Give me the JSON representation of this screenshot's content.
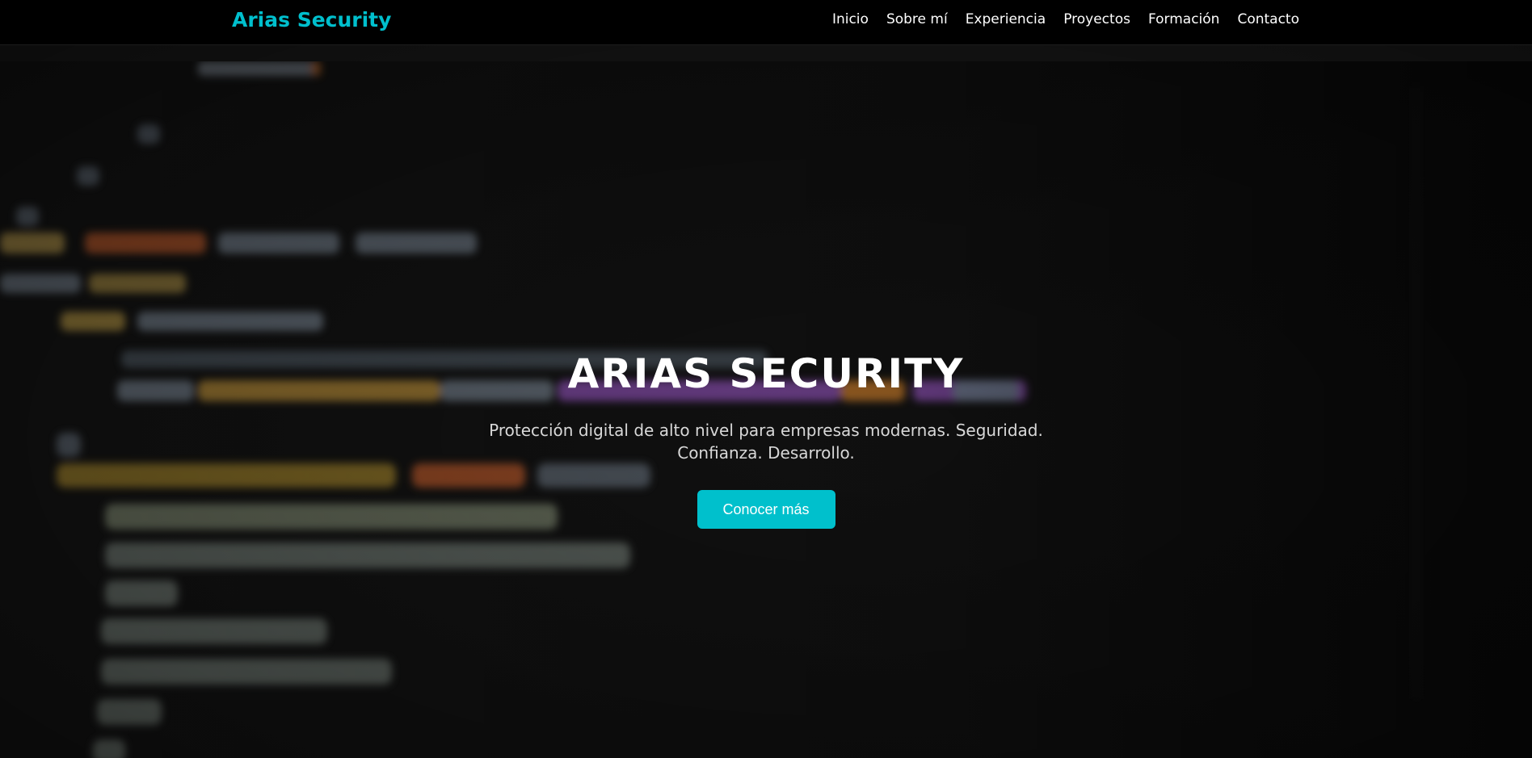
{
  "navbar": {
    "brand": "Arias Security",
    "links": [
      "Inicio",
      "Sobre mí",
      "Experiencia",
      "Proyectos",
      "Formación",
      "Contacto"
    ]
  },
  "hero": {
    "title": "ARIAS SECURITY",
    "subtitle": "Protección digital de alto nivel para empresas modernas. Seguridad. Confianza. Desarrollo.",
    "cta_label": "Conocer más",
    "background": "blurred-source-code-photo"
  },
  "colors": {
    "accent": "#00bfcd",
    "navbar_bg": "#000000",
    "hero_text": "#ffffff"
  }
}
